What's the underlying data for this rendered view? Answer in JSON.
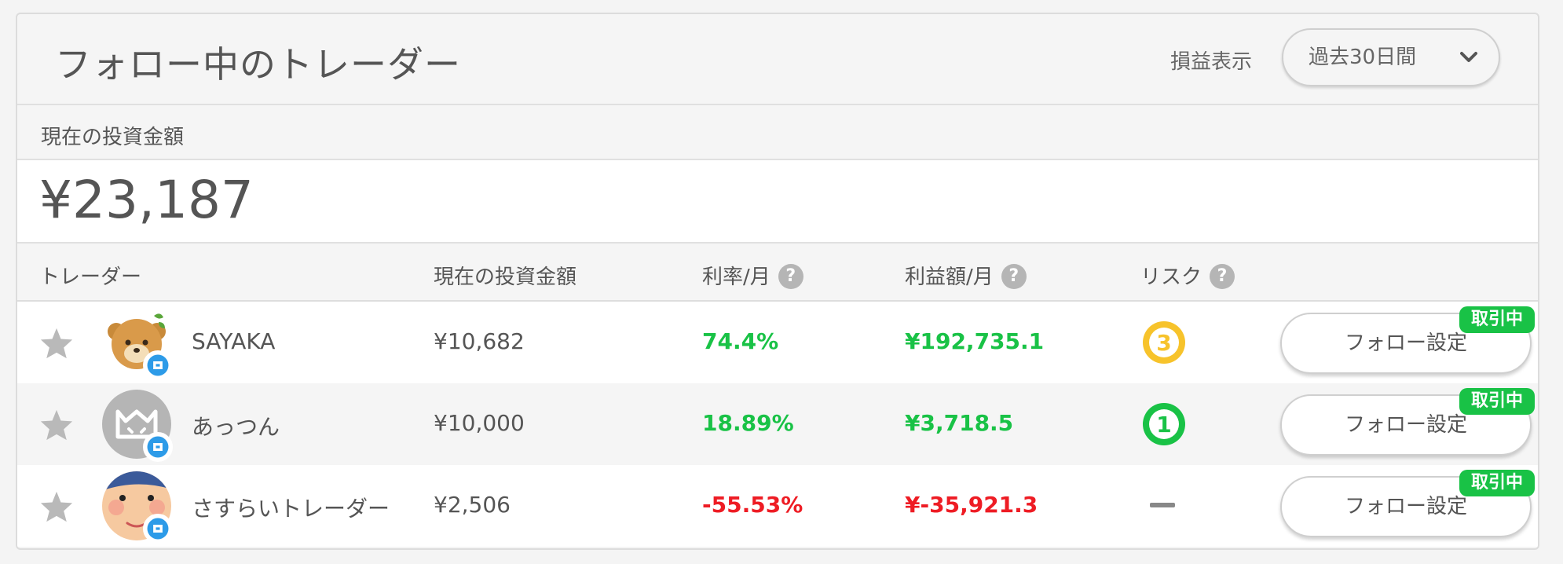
{
  "header": {
    "title": "フォロー中のトレーダー",
    "pnl_label": "損益表示",
    "period_selected": "過去30日間"
  },
  "summary": {
    "label": "現在の投資金額",
    "total": "¥23,187"
  },
  "columns": {
    "trader": "トレーダー",
    "investment": "現在の投資金額",
    "rate": "利率/月",
    "profit": "利益額/月",
    "risk": "リスク"
  },
  "help_glyph": "?",
  "colors": {
    "positive": "#19c246",
    "negative": "#ee1c24",
    "badge": "#2d9be8",
    "risk3": "#f7c32b",
    "risk1": "#19c246"
  },
  "traders": [
    {
      "name": "SAYAKA",
      "investment": "¥10,682",
      "rate": "74.4%",
      "profit": "¥192,735.1",
      "risk": "3",
      "follow_label": "フォロー設定",
      "status": "取引中",
      "trend": "positive"
    },
    {
      "name": "あっつん",
      "investment": "¥10,000",
      "rate": "18.89%",
      "profit": "¥3,718.5",
      "risk": "1",
      "follow_label": "フォロー設定",
      "status": "取引中",
      "trend": "positive"
    },
    {
      "name": "さすらいトレーダー",
      "investment": "¥2,506",
      "rate": "-55.53%",
      "profit": "¥-35,921.3",
      "risk": "",
      "follow_label": "フォロー設定",
      "status": "取引中",
      "trend": "negative"
    }
  ]
}
